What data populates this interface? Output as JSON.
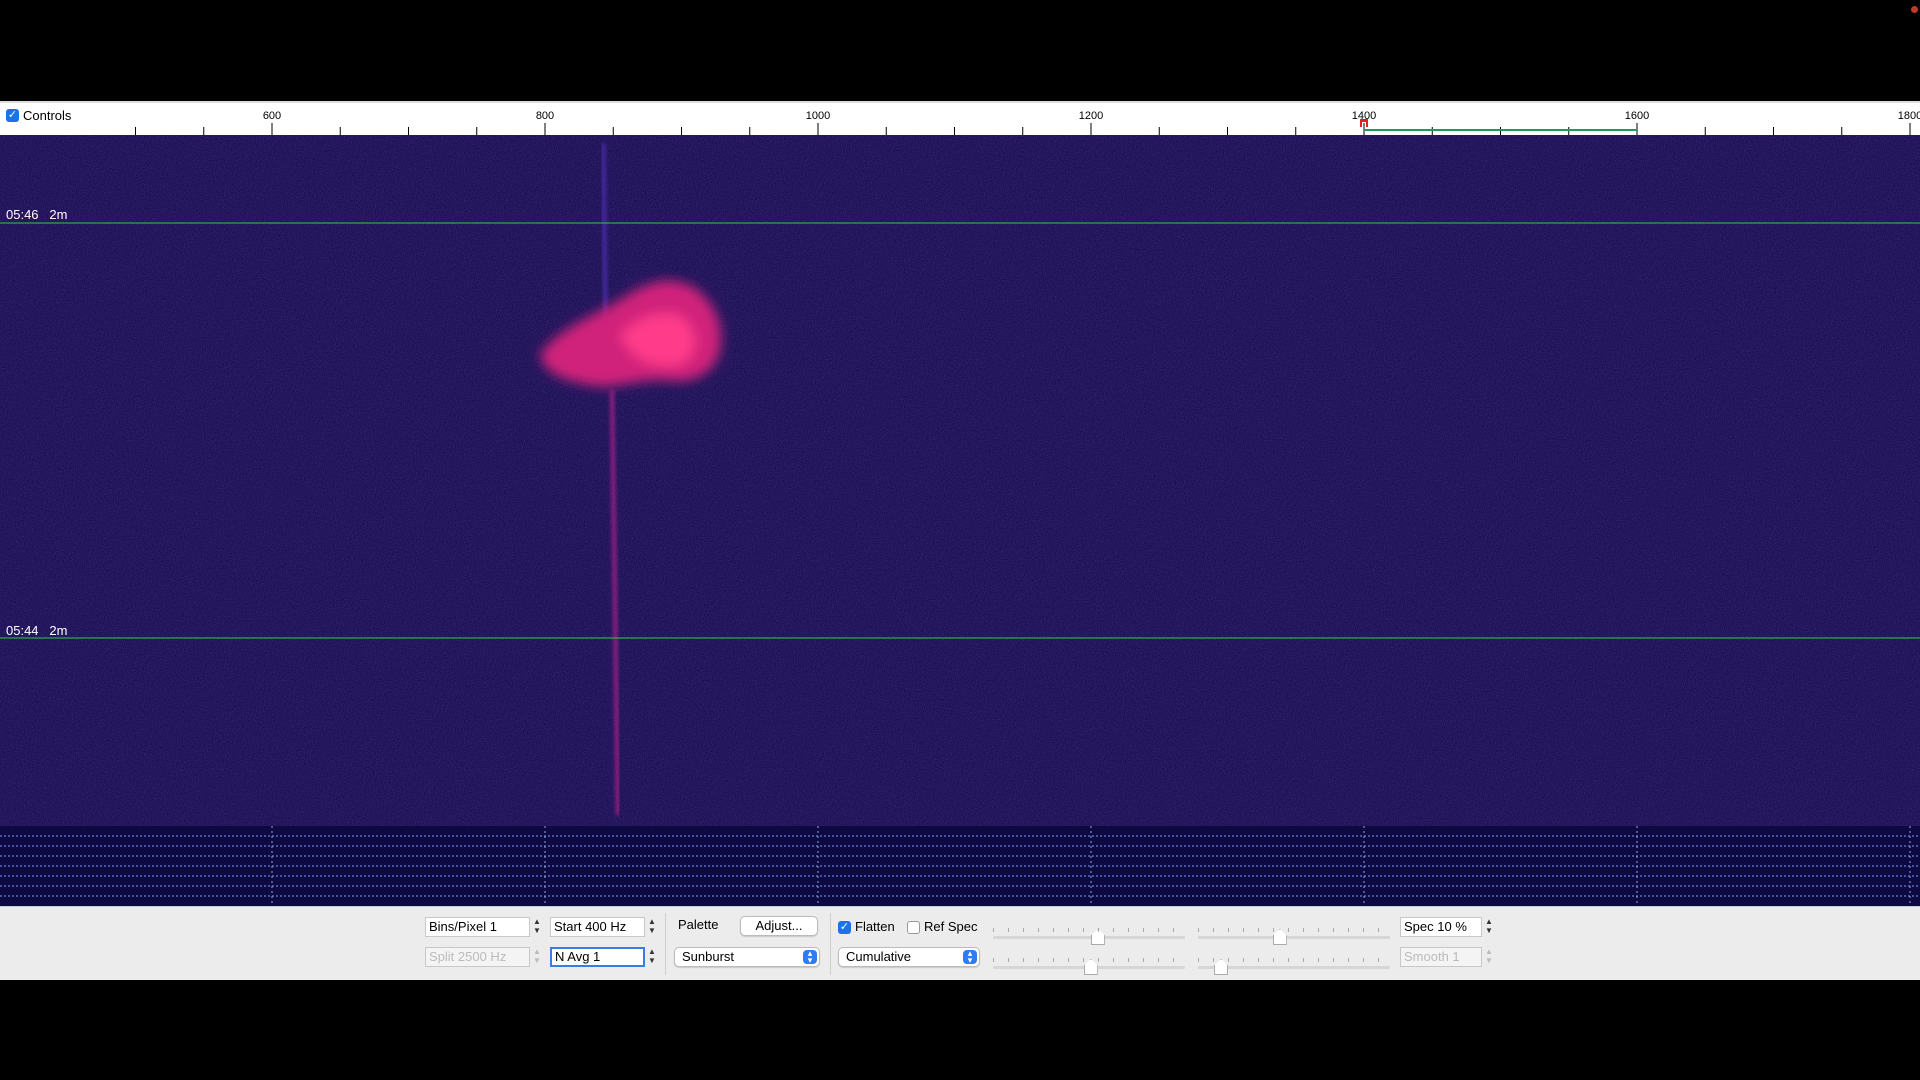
{
  "scale": {
    "controls_label": "Controls",
    "controls_checked": true,
    "ticks": [
      "600",
      "800",
      "1000",
      "1200",
      "1400",
      "1600",
      "1800"
    ]
  },
  "waterfall": {
    "timestamps": [
      {
        "time": "05:46",
        "interval": "2m"
      },
      {
        "time": "05:44",
        "interval": "2m"
      }
    ]
  },
  "controls": {
    "bins_pixel": "Bins/Pixel  1",
    "start": "Start 400 Hz",
    "split": "Split  2500  Hz",
    "navg": "N Avg 1",
    "palette_label": "Palette",
    "adjust_button": "Adjust...",
    "palette_value": "Sunburst",
    "flatten_label": "Flatten",
    "flatten_checked": true,
    "refspec_label": "Ref Spec",
    "refspec_checked": false,
    "mode_value": "Cumulative",
    "spec": "Spec 10 %",
    "smooth": "Smooth  1",
    "slider_levels": [
      0.55,
      0.42,
      0.51,
      0.09
    ]
  },
  "colors": {
    "waterfall_bg": "#0a0838",
    "signal": "#ff2a7a",
    "marker_line": "#2ecc40",
    "range_bar": "#1b9c5a",
    "checkbox": "#1a73e8"
  }
}
